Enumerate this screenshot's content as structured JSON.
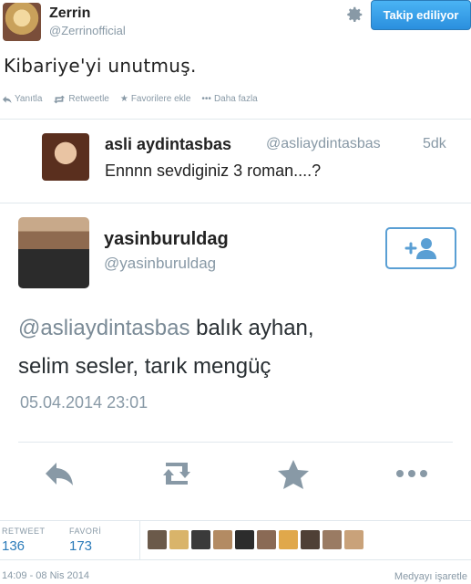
{
  "tweet": {
    "author_name": "Zerrin",
    "author_handle": "@Zerrinofficial",
    "follow_button": "Takip ediliyor",
    "text": "Kibariye'yi unutmuş.",
    "actions": {
      "reply": "Yanıtla",
      "retweet": "Retweetle",
      "favorite": "Favorilere ekle",
      "more": "Daha fazla"
    }
  },
  "quoted": {
    "name": "asli aydintasbas",
    "handle": "@asliaydintasbas",
    "time": "5dk",
    "text": "Ennnn sevdiginiz 3 roman....?"
  },
  "reply": {
    "name": "yasinburuldag",
    "handle": "@yasinburuldag",
    "mention": "@asliaydintasbas",
    "text_after_mention": " balık ayhan,",
    "text_line2": "selim sesler, tarık mengüç",
    "datetime": "05.04.2014 23:01"
  },
  "stats": {
    "retweet_label": "RETWEET",
    "retweet_count": "136",
    "favori_label": "FAVORİ",
    "favori_count": "173"
  },
  "footer": {
    "timestamp": "14:09 - 08 Nis 2014",
    "flag_media": "Medyayı işaretle"
  },
  "colors": {
    "accent": "#2b7bb9",
    "muted": "#8899a6",
    "follow_bg": "#3ea1ec"
  }
}
